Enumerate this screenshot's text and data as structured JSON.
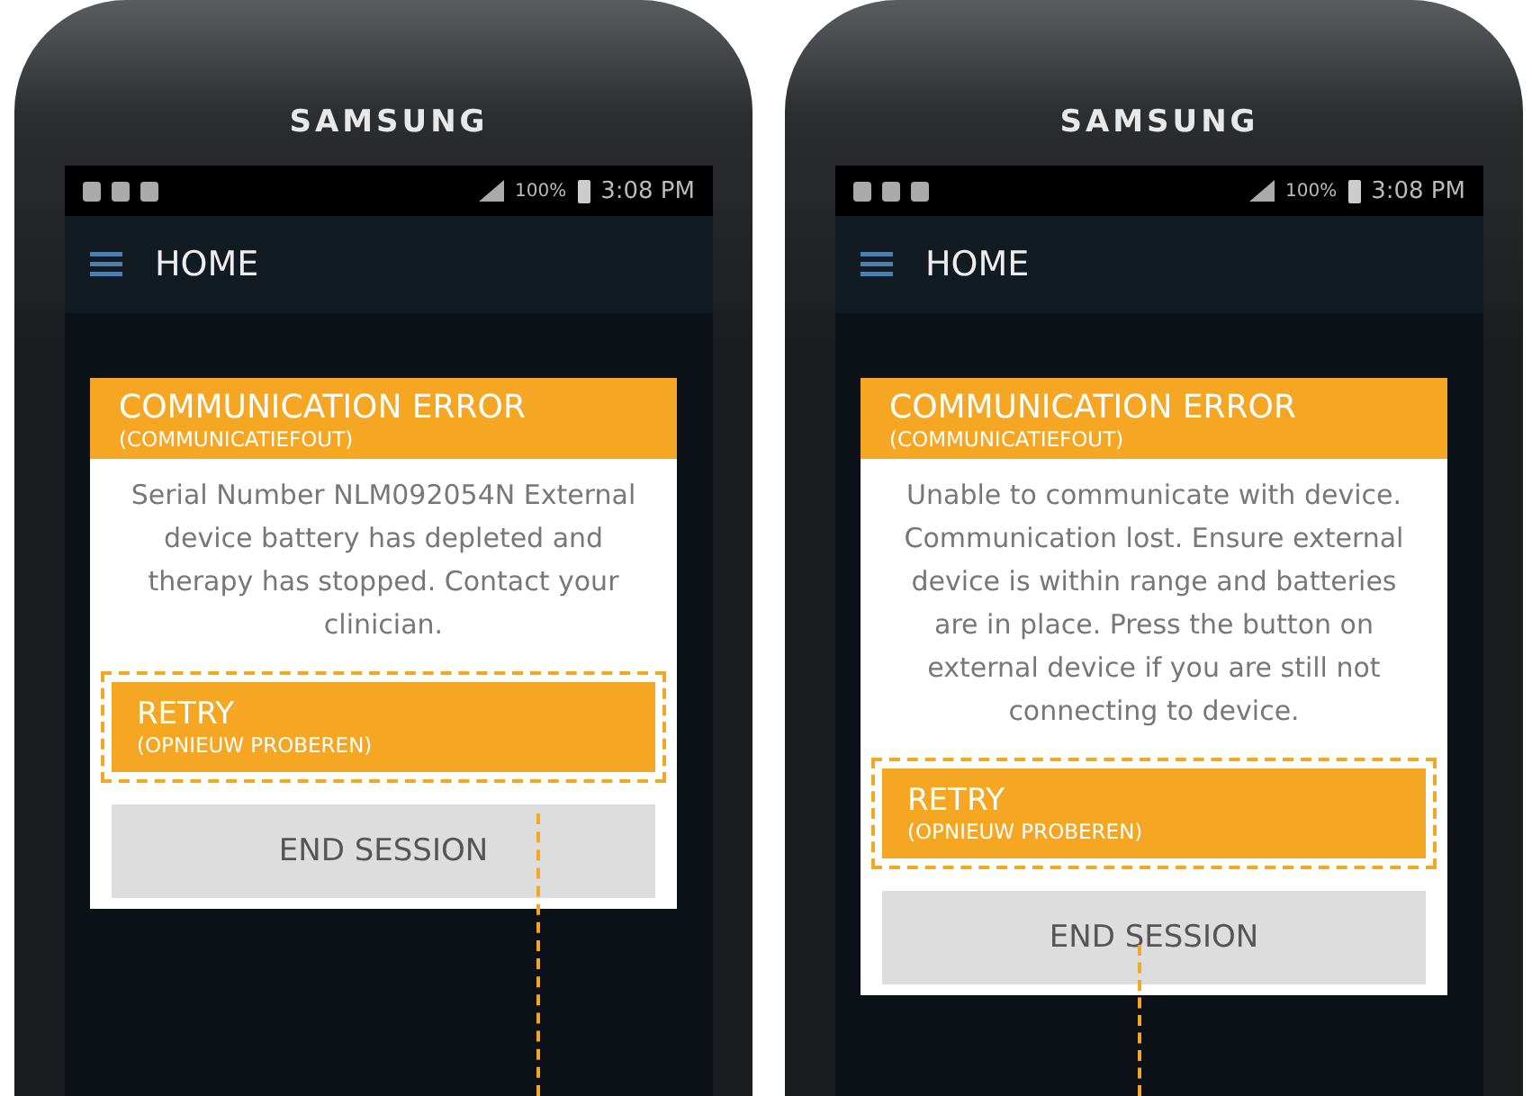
{
  "phones": [
    {
      "brand": "SAMSUNG",
      "status": {
        "battery": "100%",
        "time": "3:08 PM"
      },
      "app_bar": {
        "title": "HOME"
      },
      "dialog": {
        "title": "COMMUNICATION ERROR",
        "subtitle": "(COMMUNICATIEFOUT)",
        "message": "Serial Number NLM092054N External device battery has depleted and therapy has stopped. Contact your clinician.",
        "buttons": [
          {
            "kind": "primary",
            "label": "RETRY",
            "sublabel": "(OPNIEUW PROBEREN)",
            "highlighted": true
          },
          {
            "kind": "secondary",
            "label": "END SESSION",
            "highlighted": false
          }
        ]
      }
    },
    {
      "brand": "SAMSUNG",
      "status": {
        "battery": "100%",
        "time": "3:08 PM"
      },
      "app_bar": {
        "title": "HOME"
      },
      "dialog": {
        "title": "COMMUNICATION ERROR",
        "subtitle": "(COMMUNICATIEFOUT)",
        "message": "Unable to communicate with device. Communication lost. Ensure external device is within range and batteries are in place. Press the button on external device if you are still not connecting to device.",
        "buttons": [
          {
            "kind": "primary",
            "label": "RETRY",
            "sublabel": "(OPNIEUW PROBEREN)",
            "highlighted": true
          },
          {
            "kind": "secondary",
            "label": "END SESSION",
            "highlighted": false
          }
        ]
      }
    }
  ]
}
